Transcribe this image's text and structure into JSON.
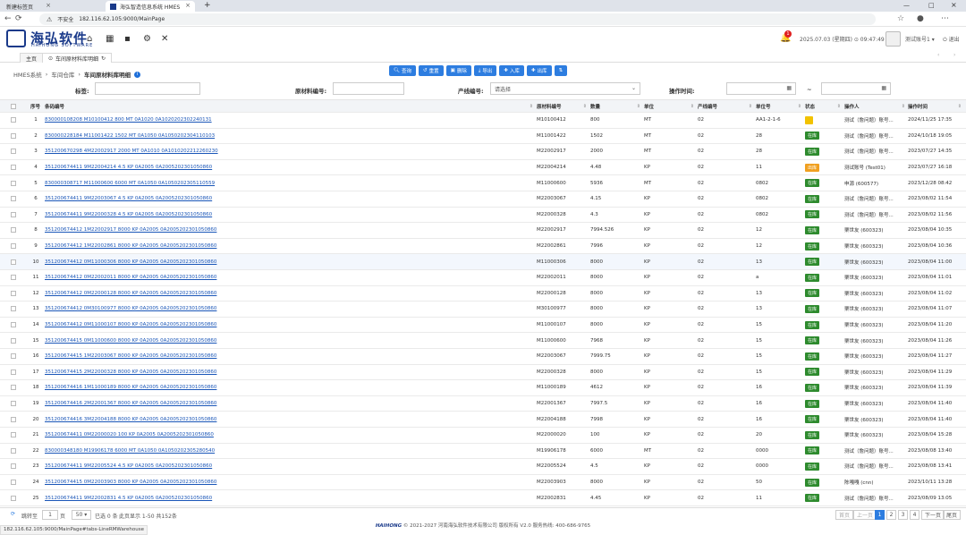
{
  "browser": {
    "tabs": [
      "新建标签页",
      "海弘智造信息系统 HMES"
    ],
    "security_label": "不安全",
    "url": "182.116.62.105:9000/MainPage",
    "status_url": "182.116.62.105:9000/MainPage#tabs-LineRMWarehouse"
  },
  "header": {
    "logo_cn": "海弘软件",
    "logo_en": "HAIHONG SOFTWARE",
    "notification_count": "1",
    "datetime": "2025.07.03 (星期四)  ⊙ 09:47:49",
    "user": "测试账号1 ▾",
    "logout": "退出"
  },
  "page_tabs": {
    "home": "主页",
    "current": "车间原材料库明细"
  },
  "breadcrumb": [
    "HMES系统",
    "车间仓库",
    "车间原材料库明细"
  ],
  "toolbar": [
    "查询",
    "重置",
    "删除",
    "导出",
    "入库",
    "出库"
  ],
  "filters": {
    "tag_label": "标签:",
    "material_label": "原材料编号:",
    "line_label": "产线编号:",
    "line_value": "请选择",
    "time_label": "操作时间:",
    "time_sep": "~"
  },
  "columns": [
    "序号",
    "条码编号",
    "原材料编号",
    "数量",
    "单位",
    "产线编号",
    "单位号",
    "状态",
    "操作人",
    "操作时间"
  ],
  "rows": [
    [
      "1",
      "830000108208 M10100412 800 MT 0A1020 0A1020202302240131",
      "M10100412",
      "800",
      "MT",
      "02",
      "AA1-2-1-6",
      "",
      "测试（詹问题）账号...",
      "2024/11/25 17:35"
    ],
    [
      "2",
      "830000228184 M11001422 1502 MT 0A1050 0A1050202304110103",
      "M11001422",
      "1502",
      "MT",
      "02",
      "28",
      "在库",
      "测试（詹问题）账号...",
      "2024/10/18 19:05"
    ],
    [
      "3",
      "351200670298 4M22002917 2000 MT 0A1010 0A1010202212260230",
      "M22002917",
      "2000",
      "MT",
      "02",
      "28",
      "在库",
      "测试（詹问题）账号...",
      "2023/07/27 14:35"
    ],
    [
      "4",
      "351200674411 9M22004214 4.5 KP 0A2005 0A2005202301050860",
      "M22004214",
      "4.48",
      "KP",
      "02",
      "11",
      "出库",
      "测试账号 (Test01)",
      "2023/07/27 16:18"
    ],
    [
      "5",
      "830000308717 M11000600 6000 MT 0A1050 0A1050202305110559",
      "M11000600",
      "5936",
      "MT",
      "02",
      "0802",
      "在库",
      "申源 (600577)",
      "2023/12/28 08:42"
    ],
    [
      "6",
      "351200674411 9M22003067 4.5 KP 0A2005 0A2005202301050860",
      "M22003067",
      "4.15",
      "KP",
      "02",
      "0802",
      "在库",
      "测试（詹问题）账号...",
      "2023/08/02 11:54"
    ],
    [
      "7",
      "351200674411 9M22000328 4.5 KP 0A2005 0A2005202301050860",
      "M22000328",
      "4.3",
      "KP",
      "02",
      "0802",
      "在库",
      "测试（詹问题）账号...",
      "2023/08/02 11:56"
    ],
    [
      "8",
      "351200674412 1M22002917 8000 KP 0A2005 0A2005202301050860",
      "M22002917",
      "7994.526",
      "KP",
      "02",
      "12",
      "在库",
      "栗世友 (600323)",
      "2023/08/04 10:35"
    ],
    [
      "9",
      "351200674412 1M22002861 8000 KP 0A2005 0A2005202301050860",
      "M22002861",
      "7996",
      "KP",
      "02",
      "12",
      "在库",
      "栗世友 (600323)",
      "2023/08/04 10:36"
    ],
    [
      "10",
      "351200674412 0M11000306 8000 KP 0A2005 0A2005202301050860",
      "M11000306",
      "8000",
      "KP",
      "02",
      "13",
      "在库",
      "栗世友 (600323)",
      "2023/08/04 11:00"
    ],
    [
      "11",
      "351200674412 0M22002011 8000 KP 0A2005 0A2005202301050860",
      "M22002011",
      "8000",
      "KP",
      "02",
      "a",
      "在库",
      "栗世友 (600323)",
      "2023/08/04 11:01"
    ],
    [
      "12",
      "351200674412 0M22000128 8000 KP 0A2005 0A2005202301050860",
      "M22000128",
      "8000",
      "KP",
      "02",
      "13",
      "在库",
      "栗世友 (600323)",
      "2023/08/04 11:02"
    ],
    [
      "13",
      "351200674412 0M30100977 8000 KP 0A2005 0A2005202301050860",
      "M30100977",
      "8000",
      "KP",
      "02",
      "13",
      "在库",
      "栗世友 (600323)",
      "2023/08/04 11:07"
    ],
    [
      "14",
      "351200674412 0M11000107 8000 KP 0A2005 0A2005202301050860",
      "M11000107",
      "8000",
      "KP",
      "02",
      "15",
      "在库",
      "栗世友 (600323)",
      "2023/08/04 11:20"
    ],
    [
      "15",
      "351200674415 0M11000600 8000 KP 0A2005 0A2005202301050860",
      "M11000600",
      "7968",
      "KP",
      "02",
      "15",
      "在库",
      "栗世友 (600323)",
      "2023/08/04 11:26"
    ],
    [
      "16",
      "351200674415 1M22003067 8000 KP 0A2005 0A2005202301050860",
      "M22003067",
      "7999.75",
      "KP",
      "02",
      "15",
      "在库",
      "栗世友 (600323)",
      "2023/08/04 11:27"
    ],
    [
      "17",
      "351200674415 2M22000328 8000 KP 0A2005 0A2005202301050860",
      "M22000328",
      "8000",
      "KP",
      "02",
      "15",
      "在库",
      "栗世友 (600323)",
      "2023/08/04 11:29"
    ],
    [
      "18",
      "351200674416 1M11000189 8000 KP 0A2005 0A2005202301050860",
      "M11000189",
      "4612",
      "KP",
      "02",
      "16",
      "在库",
      "栗世友 (600323)",
      "2023/08/04 11:39"
    ],
    [
      "19",
      "351200674416 2M22001367 8000 KP 0A2005 0A2005202301050860",
      "M22001367",
      "7997.5",
      "KP",
      "02",
      "16",
      "在库",
      "栗世友 (600323)",
      "2023/08/04 11:40"
    ],
    [
      "20",
      "351200674416 3M22004188 8000 KP 0A2005 0A2005202301050860",
      "M22004188",
      "7998",
      "KP",
      "02",
      "16",
      "在库",
      "栗世友 (600323)",
      "2023/08/04 11:40"
    ],
    [
      "21",
      "351200674411 0M22000020 100 KP 0A2005 0A2005202301050860",
      "M22000020",
      "100",
      "KP",
      "02",
      "20",
      "在库",
      "栗世友 (600323)",
      "2023/08/04 15:28"
    ],
    [
      "22",
      "830000348180 M19906178 6000 MT 0A1050 0A1050202305280540",
      "M19906178",
      "6000",
      "MT",
      "02",
      "0000",
      "在库",
      "测试（詹问题）账号...",
      "2023/08/08 13:40"
    ],
    [
      "23",
      "351200674411 9M22005524 4.5 KP 0A2005 0A2005202301050860",
      "M22005524",
      "4.5",
      "KP",
      "02",
      "0000",
      "在库",
      "测试（詹问题）账号...",
      "2023/08/08 13:41"
    ],
    [
      "24",
      "351200674415 0M22003903 8000 KP 0A2005 0A2005202301050860",
      "M22003903",
      "8000",
      "KP",
      "02",
      "50",
      "在库",
      "陈嘎嘎 (cnn)",
      "2023/10/11 13:28"
    ],
    [
      "25",
      "351200674411 9M22002831 4.5 KP 0A2005 0A2005202301050860",
      "M22002831",
      "4.45",
      "KP",
      "02",
      "11",
      "在库",
      "测试（詹问题）账号...",
      "2023/08/09 13:05"
    ]
  ],
  "status_colors": {
    "在库": "#2e8b2e",
    "出库": "#f0a020",
    "": "#f2c200"
  },
  "pager": {
    "goto_label": "跳转至",
    "goto_value": "1",
    "page_unit": "页",
    "page_size": "50 ▾",
    "selected": "已选 0 条",
    "summary": "此页显示 1-50 共152条",
    "prev_first": "首页",
    "prev": "上一页",
    "pages": [
      "1",
      "2",
      "3",
      "4"
    ],
    "next": "下一页",
    "last": "尾页"
  },
  "footer": {
    "copyright": "© 2021-2027 河南海弘软件技术有限公司 版权所有 V2.0 服务热线: 400-686-9765"
  }
}
